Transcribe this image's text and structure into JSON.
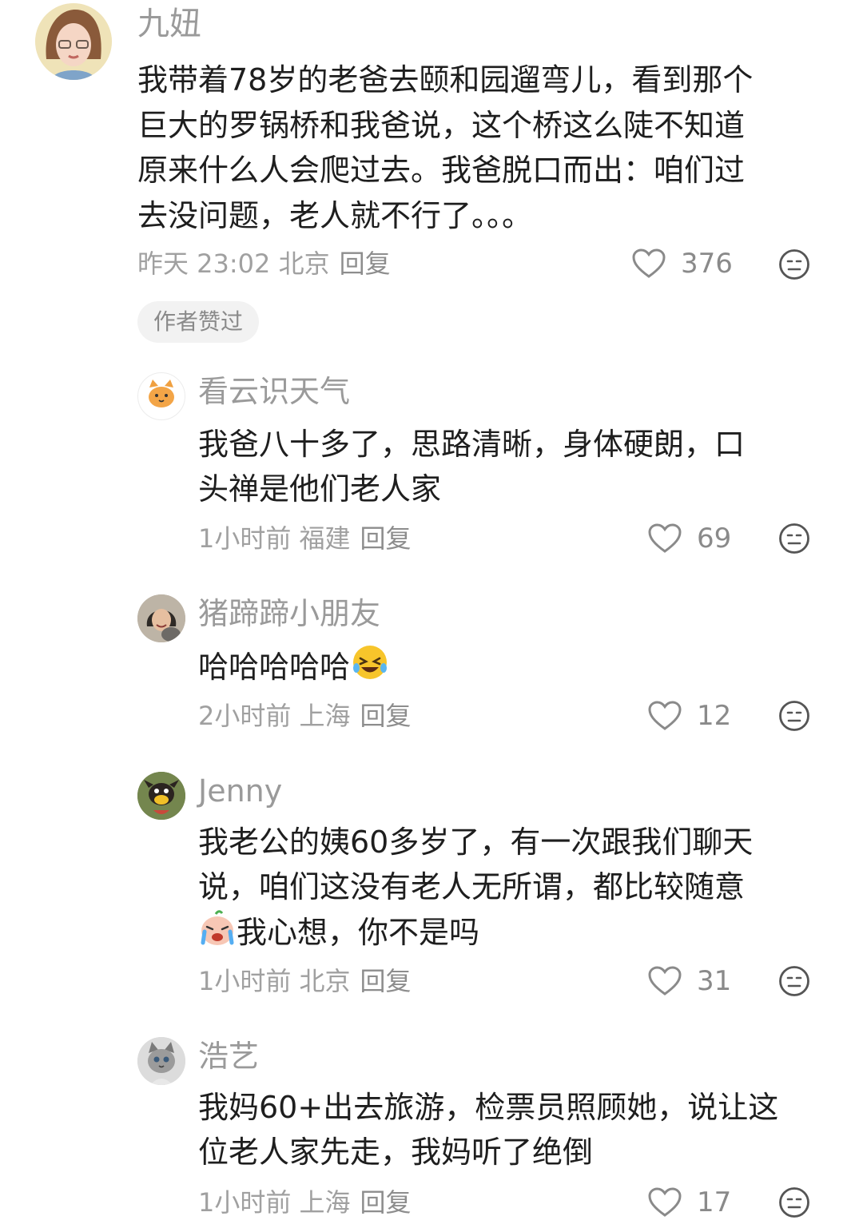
{
  "comments": [
    {
      "name": "九妞",
      "lines": [
        "我带着78岁的老爸去颐和园遛弯儿，看到那个",
        "巨大的罗锅桥和我爸说，这个桥这么陡不知道",
        "原来什么人会爬过去。我爸脱口而出：咱们过",
        "去没问题，老人就不行了。。。"
      ],
      "meta": "昨天 23:02 北京",
      "reply": "回复",
      "likes": "376",
      "badge": "作者赞过"
    },
    {
      "name": "看云识天气",
      "lines": [
        "我爸八十多了，思路清晰，身体硬朗，口",
        "头禅是他们老人家"
      ],
      "meta": "1小时前 福建",
      "reply": "回复",
      "likes": "69"
    },
    {
      "name": "猪蹄蹄小朋友",
      "lines": [
        "哈哈哈哈哈"
      ],
      "meta": "2小时前 上海",
      "reply": "回复",
      "likes": "12"
    },
    {
      "name": "Jenny",
      "lines": [
        "我老公的姨60多岁了，有一次跟我们聊天",
        "说，咱们这没有老人无所谓，都比较随意",
        "我心想，你不是吗"
      ],
      "meta": "1小时前 北京",
      "reply": "回复",
      "likes": "31"
    },
    {
      "name": "浩艺",
      "lines": [
        "我妈60+出去旅游，检票员照顾她，说让这",
        "位老人家先走，我妈听了绝倒"
      ],
      "meta": "1小时前 上海",
      "reply": "回复",
      "likes": "17"
    }
  ],
  "icons": {
    "like": "heart-outline-icon",
    "dislike": "meh-face-icon",
    "emoji_laugh": "rolling-laughing-emoji",
    "emoji_cry": "crying-emoji"
  },
  "colors": {
    "name": "#9a9a9a",
    "meta": "#a0a0a0",
    "badge_bg": "#f2f2f2"
  }
}
